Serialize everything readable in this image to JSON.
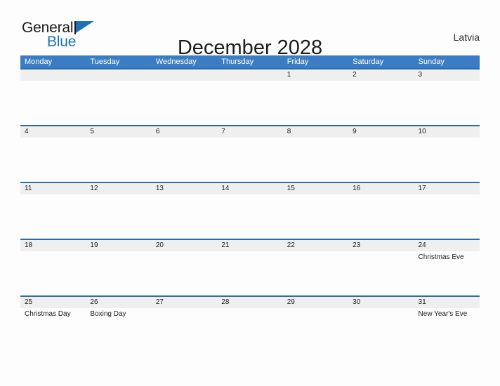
{
  "brand": {
    "line1": "General",
    "line2": "Blue",
    "flag_color": "#1d72b8"
  },
  "header": {
    "title": "December 2028",
    "region": "Latvia"
  },
  "calendar": {
    "header_color": "#3b7dc4",
    "band_color": "#efefef",
    "rule_color": "#2e6da4",
    "weekdays": [
      "Monday",
      "Tuesday",
      "Wednesday",
      "Thursday",
      "Friday",
      "Saturday",
      "Sunday"
    ],
    "weeks": [
      [
        {
          "day": "",
          "event": ""
        },
        {
          "day": "",
          "event": ""
        },
        {
          "day": "",
          "event": ""
        },
        {
          "day": "",
          "event": ""
        },
        {
          "day": "1",
          "event": ""
        },
        {
          "day": "2",
          "event": ""
        },
        {
          "day": "3",
          "event": ""
        }
      ],
      [
        {
          "day": "4",
          "event": ""
        },
        {
          "day": "5",
          "event": ""
        },
        {
          "day": "6",
          "event": ""
        },
        {
          "day": "7",
          "event": ""
        },
        {
          "day": "8",
          "event": ""
        },
        {
          "day": "9",
          "event": ""
        },
        {
          "day": "10",
          "event": ""
        }
      ],
      [
        {
          "day": "11",
          "event": ""
        },
        {
          "day": "12",
          "event": ""
        },
        {
          "day": "13",
          "event": ""
        },
        {
          "day": "14",
          "event": ""
        },
        {
          "day": "15",
          "event": ""
        },
        {
          "day": "16",
          "event": ""
        },
        {
          "day": "17",
          "event": ""
        }
      ],
      [
        {
          "day": "18",
          "event": ""
        },
        {
          "day": "19",
          "event": ""
        },
        {
          "day": "20",
          "event": ""
        },
        {
          "day": "21",
          "event": ""
        },
        {
          "day": "22",
          "event": ""
        },
        {
          "day": "23",
          "event": ""
        },
        {
          "day": "24",
          "event": "Christmas Eve"
        }
      ],
      [
        {
          "day": "25",
          "event": "Christmas Day"
        },
        {
          "day": "26",
          "event": "Boxing Day"
        },
        {
          "day": "27",
          "event": ""
        },
        {
          "day": "28",
          "event": ""
        },
        {
          "day": "29",
          "event": ""
        },
        {
          "day": "30",
          "event": ""
        },
        {
          "day": "31",
          "event": "New Year's Eve"
        }
      ]
    ]
  }
}
